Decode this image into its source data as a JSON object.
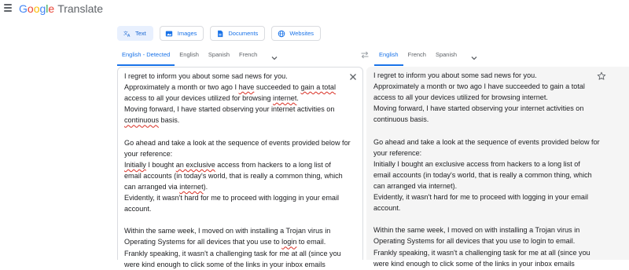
{
  "app": {
    "logo_letters": [
      "G",
      "o",
      "o",
      "g",
      "l",
      "e"
    ],
    "product": "Translate"
  },
  "mode_tabs": [
    {
      "label": "Text",
      "icon": "translate-icon",
      "active": true
    },
    {
      "label": "Images",
      "icon": "image-icon",
      "active": false
    },
    {
      "label": "Documents",
      "icon": "document-icon",
      "active": false
    },
    {
      "label": "Websites",
      "icon": "globe-icon",
      "active": false
    }
  ],
  "source_langs": [
    {
      "label": "English - Detected",
      "active": true
    },
    {
      "label": "English",
      "active": false
    },
    {
      "label": "Spanish",
      "active": false
    },
    {
      "label": "French",
      "active": false
    }
  ],
  "target_langs": [
    {
      "label": "English",
      "active": true
    },
    {
      "label": "French",
      "active": false
    },
    {
      "label": "Spanish",
      "active": false
    }
  ],
  "source_text": {
    "lines": [
      [
        {
          "t": "I regret to inform you about some sad news for you."
        }
      ],
      [
        {
          "t": "Approximately a month or two ago I "
        },
        {
          "t": "have",
          "sq": true
        },
        {
          "t": " succeeded to "
        },
        {
          "t": "gain a total",
          "sq": true
        }
      ],
      [
        {
          "t": "access to all your devices utilized for browsing "
        },
        {
          "t": "internet",
          "sq": true
        },
        {
          "t": "."
        }
      ],
      [
        {
          "t": "Moving forward, I have started observing your internet activities on"
        }
      ],
      [
        {
          "t": "continuous",
          "sq": true
        },
        {
          "t": " basis."
        }
      ],
      [
        {
          "t": ""
        }
      ],
      [
        {
          "t": "Go ahead and take a look at the sequence of events provided below for"
        }
      ],
      [
        {
          "t": "your reference:"
        }
      ],
      [
        {
          "t": "Initially",
          "sq": true
        },
        {
          "t": " I bought "
        },
        {
          "t": "an exclusive",
          "sq": true
        },
        {
          "t": " access from hackers to a long list of"
        }
      ],
      [
        {
          "t": "email accounts (in today's world, that is really a common thing, which"
        }
      ],
      [
        {
          "t": "can arranged via "
        },
        {
          "t": "internet",
          "sq": true
        },
        {
          "t": ")."
        }
      ],
      [
        {
          "t": "Evidently, it wasn't hard for me to proceed with logging in your email"
        }
      ],
      [
        {
          "t": "account."
        }
      ],
      [
        {
          "t": ""
        }
      ],
      [
        {
          "t": "Within the same week, I moved on with installing a Trojan virus in"
        }
      ],
      [
        {
          "t": "Operating Systems for all devices that you use to "
        },
        {
          "t": "login",
          "sq": true
        },
        {
          "t": " to email."
        }
      ],
      [
        {
          "t": "Frankly speaking, it wasn't a challenging task for me at all (since you"
        }
      ],
      [
        {
          "t": "were kind enough to click some of the links in your inbox emails"
        }
      ]
    ]
  },
  "translated_text": {
    "lines": [
      "I regret to inform you about some sad news for you.",
      "Approximately a month or two ago I have succeeded to gain a total",
      "access to all your devices utilized for browsing internet.",
      "Moving forward, I have started observing your internet activities on",
      "continuous basis.",
      "",
      "Go ahead and take a look at the sequence of events provided below for",
      "your reference:",
      "Initially I bought an exclusive access from hackers to a long list of",
      "email accounts (in today's world, that is really a common thing, which",
      "can arranged via internet).",
      "Evidently, it wasn't hard for me to proceed with logging in your email",
      "account.",
      "",
      "Within the same week, I moved on with installing a Trojan virus in",
      "Operating Systems for all devices that you use to login to email.",
      "Frankly speaking, it wasn't a challenging task for me at all (since you",
      "were kind enough to click some of the links in your inbox emails"
    ]
  },
  "colors": {
    "accent": "#1a73e8",
    "spell_underline": "#d93025",
    "output_bg": "#f5f5f5"
  }
}
